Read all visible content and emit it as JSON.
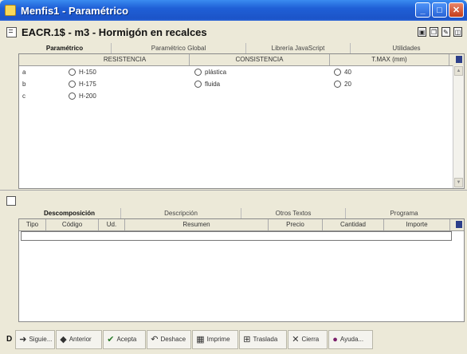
{
  "window": {
    "title": "Menfis1 - Paramétrico",
    "controls": [
      "_",
      "□",
      "✕"
    ]
  },
  "header": {
    "title": "EACR.1$ - m3 - Hormigón en recalces",
    "icons": [
      "preview-icon",
      "copy-icon",
      "edit-icon",
      "window-icon"
    ]
  },
  "tabs_top": [
    "Paramétrico",
    "Paramétrico Global",
    "Librería JavaScript",
    "Utilidades"
  ],
  "grid_top": {
    "columns": [
      "RESISTENCIA",
      "CONSISTENCIA",
      "T.MAX (mm)"
    ],
    "row_labels": [
      "a",
      "b",
      "c"
    ],
    "resistencia": [
      "H-150",
      "H-175",
      "H-200"
    ],
    "consistencia": [
      "plástica",
      "fluida"
    ],
    "tmax": [
      "40",
      "20"
    ]
  },
  "tabs_bottom": [
    "Descomposición",
    "Descripción",
    "Otros Textos",
    "Programa"
  ],
  "grid_bottom": {
    "columns": [
      "Tipo",
      "Código",
      "Ud.",
      "Resumen",
      "Precio",
      "Cantidad",
      "Importe"
    ]
  },
  "toolbar": {
    "d_label": "D",
    "buttons": [
      {
        "label": "Siguie...",
        "icon": "➜"
      },
      {
        "label": "Anterior",
        "icon": "◆"
      },
      {
        "label": "Acepta",
        "icon": "✔"
      },
      {
        "label": "Deshace",
        "icon": "↶"
      },
      {
        "label": "Imprime",
        "icon": "▦"
      },
      {
        "label": "Traslada",
        "icon": "⊞"
      },
      {
        "label": "Cierra",
        "icon": "✕"
      },
      {
        "label": "Ayuda...",
        "icon": "●"
      }
    ]
  }
}
